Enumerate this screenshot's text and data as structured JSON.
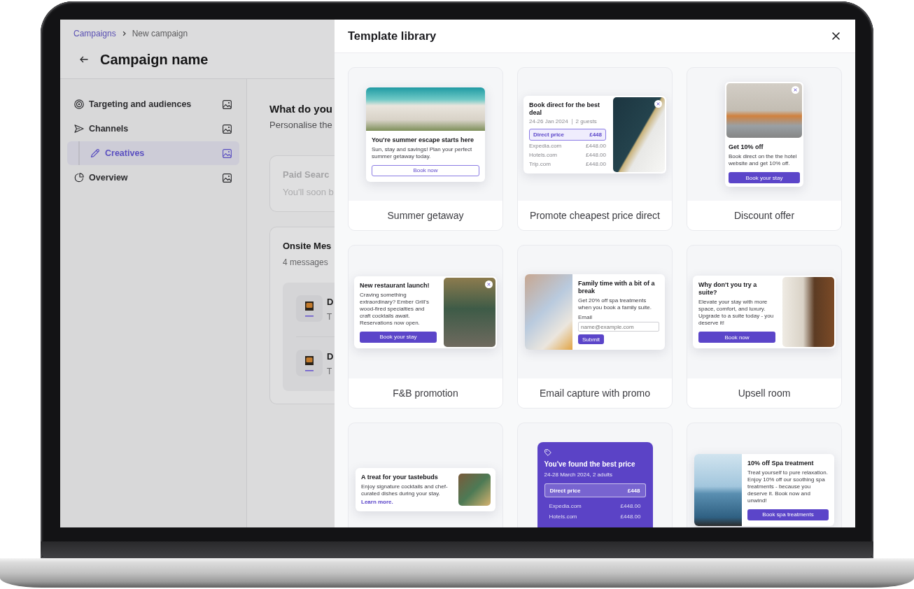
{
  "breadcrumb": [
    {
      "kind": "link",
      "label": "Campaigns"
    },
    {
      "kind": "current",
      "label": "New campaign"
    }
  ],
  "page_title": "Campaign name",
  "sidebar": {
    "items": [
      {
        "label": "Targeting and audiences",
        "selected": false
      },
      {
        "label": "Channels",
        "selected": false,
        "children": [
          {
            "label": "Creatives",
            "selected": true
          }
        ]
      },
      {
        "label": "Overview",
        "selected": false
      }
    ]
  },
  "content": {
    "heading": "What do you",
    "subheading": "Personalise the",
    "cards": [
      {
        "title": "Paid Searc",
        "subtitle": "You'll soon b",
        "disabled": true
      },
      {
        "title": "Onsite Mes",
        "subtitle": "4 messages",
        "disabled": false,
        "messages": [
          {
            "title": "D",
            "subtitle": "T"
          },
          {
            "title": "D",
            "subtitle": "T"
          }
        ]
      }
    ]
  },
  "modal": {
    "title": "Template library",
    "templates": [
      {
        "kind": "banner",
        "label": "Summer getaway",
        "close_button": false,
        "blocks": [
          {
            "kind": "title",
            "text": "You're summer escape starts here"
          },
          {
            "kind": "body",
            "text": "Sun, stay and savings! Plan your perfect summer getaway today."
          },
          {
            "kind": "outline-button",
            "text": "Book now"
          }
        ]
      },
      {
        "kind": "image-right",
        "label": "Promote cheapest price direct",
        "close_button": true,
        "blocks": [
          {
            "kind": "title",
            "text": "Book direct for the best deal"
          },
          {
            "kind": "meta",
            "items": [
              "24-26 Jan 2024",
              "2 guests"
            ]
          },
          {
            "kind": "price-box",
            "name": "Direct price",
            "price": "£448"
          },
          {
            "kind": "price-row",
            "name": "Expedia.com",
            "price": "£448.00"
          },
          {
            "kind": "price-row",
            "name": "Hotels.com",
            "price": "£448.00"
          },
          {
            "kind": "price-row",
            "name": "Trip.com",
            "price": "£448.00"
          }
        ]
      },
      {
        "kind": "portrait",
        "label": "Discount offer",
        "close_button": true,
        "blocks": [
          {
            "kind": "title",
            "text": "Get 10% off"
          },
          {
            "kind": "body",
            "text": "Book direct on the the hotel website and get 10% off."
          },
          {
            "kind": "filled-button",
            "text": "Book your stay"
          }
        ]
      },
      {
        "kind": "image-right",
        "label": "F&B promotion",
        "close_button": true,
        "blocks": [
          {
            "kind": "title",
            "text": "New restaurant launch!"
          },
          {
            "kind": "body",
            "text": "Craving something extraordinary? Ember Grill's wood-fired specialties and craft cocktails await. Reservations now open."
          },
          {
            "kind": "filled-button",
            "text": "Book your stay"
          }
        ]
      },
      {
        "kind": "image-left",
        "label": "Email capture with promo",
        "close_button": false,
        "blocks": [
          {
            "kind": "title",
            "text": "Family time with a bit of a break"
          },
          {
            "kind": "body",
            "text": "Get 20% off spa treatments when you book a family suite."
          },
          {
            "kind": "field",
            "label": "Email",
            "placeholder": "name@example.com"
          },
          {
            "kind": "compact-button",
            "text": "Submit"
          }
        ]
      },
      {
        "kind": "image-right",
        "label": "Upsell room",
        "close_button": false,
        "blocks": [
          {
            "kind": "title",
            "text": "Why don't you try a suite?"
          },
          {
            "kind": "body",
            "text": "Elevate your stay with more space, comfort, and luxury. Upgrade to a suite today - you deserve it!"
          },
          {
            "kind": "filled-button",
            "text": "Book now"
          }
        ]
      },
      {
        "kind": "thumb-right",
        "close_button": false,
        "blocks": [
          {
            "kind": "title",
            "text": "A treat for your tastebuds"
          },
          {
            "kind": "body",
            "text": "Enjoy signature cocktails and chef-curated dishes during your stay."
          },
          {
            "kind": "link",
            "text": "Learn more."
          }
        ]
      },
      {
        "kind": "price-card",
        "blocks": [
          {
            "kind": "title",
            "text": "You've found the best price"
          },
          {
            "kind": "meta",
            "items": [
              "24-28 March 2024, 2 adults"
            ]
          },
          {
            "kind": "price-box",
            "name": "Direct price",
            "price": "£448"
          },
          {
            "kind": "price-row",
            "name": "Expedia.com",
            "price": "£448.00"
          },
          {
            "kind": "price-row",
            "name": "Hotels.com",
            "price": "£448.00"
          }
        ]
      },
      {
        "kind": "image-left",
        "close_button": false,
        "blocks": [
          {
            "kind": "title",
            "text": "10% off Spa treatment"
          },
          {
            "kind": "body",
            "text": "Treat yourself to pure relaxation. Enjoy 10% off our soothing spa treatments - because you deserve it. Book now and unwind!"
          },
          {
            "kind": "filled-button",
            "text": "Book spa treatments"
          }
        ]
      }
    ]
  }
}
